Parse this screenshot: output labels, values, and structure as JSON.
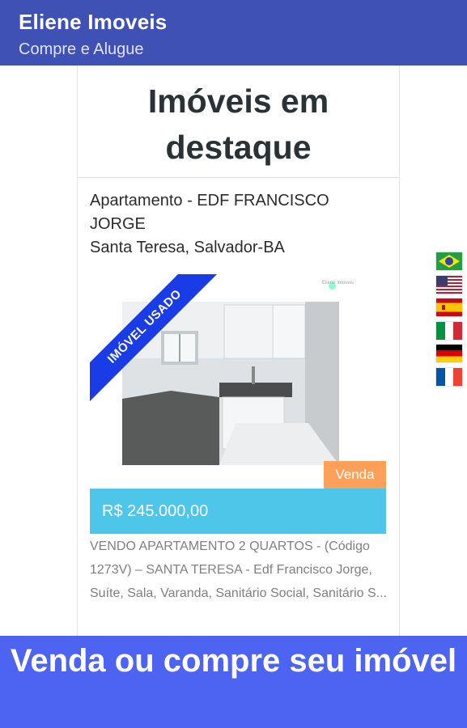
{
  "appbar": {
    "title": "Eliene Imoveis",
    "subtitle": "Compre e Alugue",
    "color": "#3f51b5"
  },
  "featured": {
    "heading": "Imóveis em destaque",
    "listing": {
      "title_line1": "Apartamento - EDF FRANCISCO JORGE",
      "location": "Santa Teresa, Salvador-BA",
      "ribbon": "IMÓVEL USADO",
      "photo_watermark": "Eliene Imoveis",
      "status_badge": "Venda",
      "price": "R$ 245.000,00",
      "description": "VENDO APARTAMENTO 2 QUARTOS - (Código 1273V) – SANTA TERESA - Edf Francisco Jorge, Suíte, Sala, Varanda, Sanitário Social, Sanitário S..."
    }
  },
  "languages": [
    {
      "icon": "flag-brazil-icon"
    },
    {
      "icon": "flag-usa-icon"
    },
    {
      "icon": "flag-spain-icon"
    },
    {
      "icon": "flag-italy-icon"
    },
    {
      "icon": "flag-germany-icon"
    },
    {
      "icon": "flag-france-icon"
    }
  ],
  "banner": {
    "text": "Venda ou compre seu imóvel",
    "color": "#4d63f2"
  },
  "colors": {
    "price_bar": "#4dc6ea",
    "badge": "#ffa05a",
    "ribbon": "#1a3ce6"
  }
}
